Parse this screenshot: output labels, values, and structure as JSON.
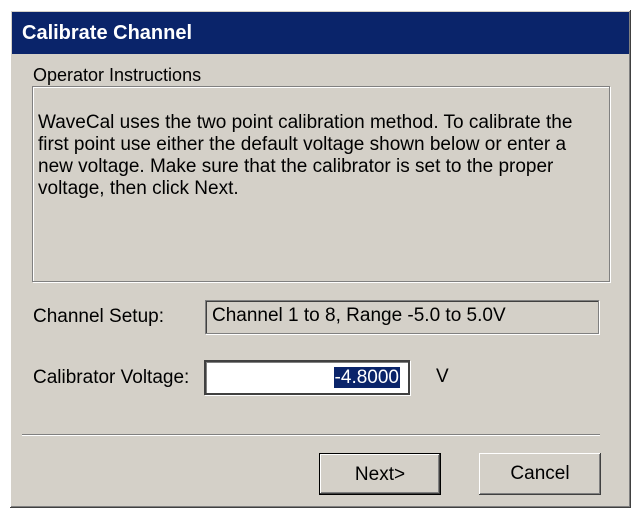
{
  "window": {
    "title": "Calibrate Channel"
  },
  "instructions": {
    "group_label": "Operator Instructions",
    "text": "WaveCal uses the two point calibration method.  To calibrate the first point use either the default voltage shown below or enter a new voltage.  Make sure that the calibrator is set to the proper voltage, then click Next."
  },
  "fields": {
    "channel_setup_label": "Channel Setup:",
    "channel_setup_value": "Channel 1 to 8,  Range -5.0 to 5.0V",
    "calibrator_voltage_label": "Calibrator Voltage:",
    "calibrator_voltage_value": "-4.8000",
    "calibrator_voltage_unit": "V"
  },
  "buttons": {
    "next_label": "Next>",
    "cancel_label": "Cancel"
  },
  "colors": {
    "title_bar": "#0a246a",
    "face": "#d4d0c8",
    "selection": "#0a246a"
  }
}
